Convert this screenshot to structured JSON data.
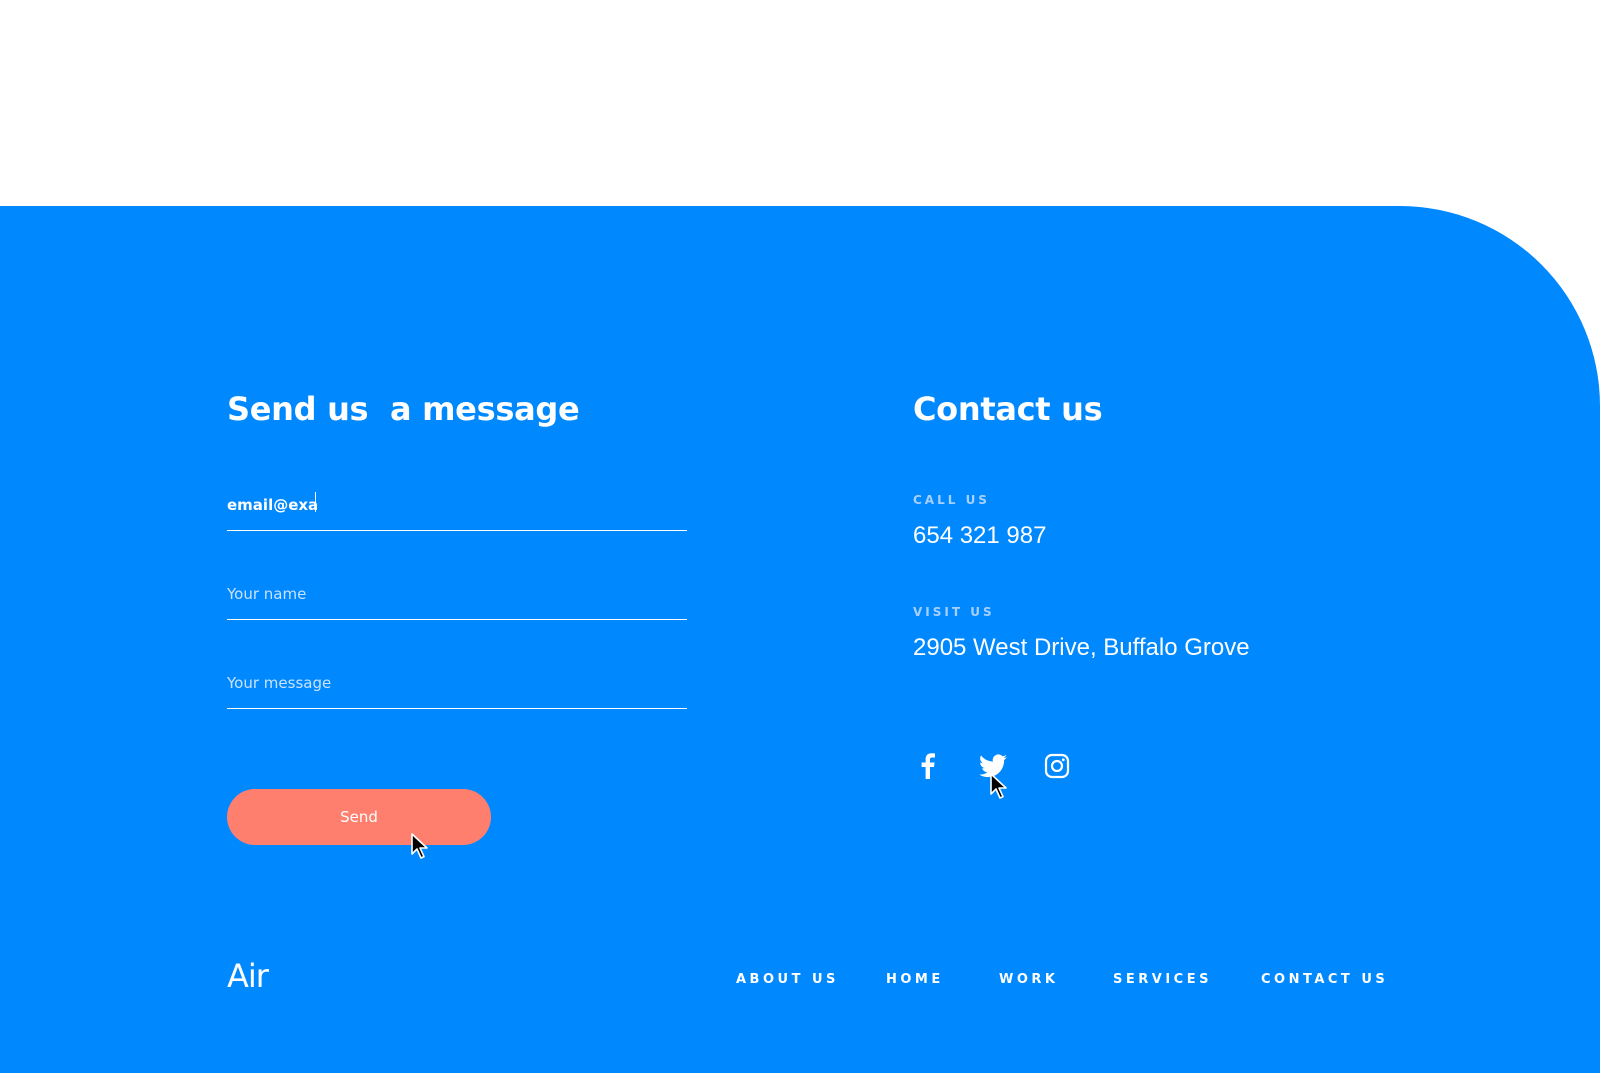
{
  "form": {
    "heading": "Send us  a message",
    "email_value": "email@exa",
    "name_placeholder": "Your name",
    "message_placeholder": "Your message",
    "send_label": "Send"
  },
  "contact": {
    "heading": "Contact us",
    "call_label": "CALL US",
    "phone": "654 321 987",
    "visit_label": "VISIT US",
    "address": "2905 West Drive, Buffalo Grove"
  },
  "social": {
    "icons": [
      "facebook-icon",
      "twitter-icon",
      "instagram-icon"
    ]
  },
  "logo": {
    "text": "Air"
  },
  "nav": {
    "items": [
      "ABOUT US",
      "HOME",
      "WORK",
      "SERVICES",
      "CONTACT US"
    ]
  },
  "colors": {
    "background": "#0088ff",
    "button": "#ff7f6e",
    "text": "#ffffff"
  }
}
